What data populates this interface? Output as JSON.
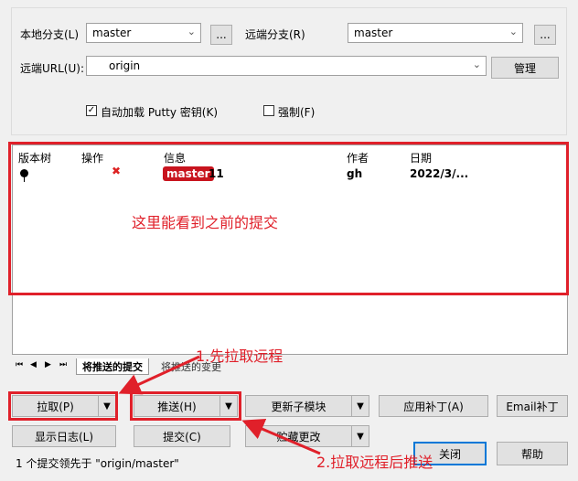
{
  "top": {
    "local_branch_label": "本地分支(L)",
    "local_branch_value": "master",
    "browse_local": "...",
    "remote_branch_label": "远端分支(R)",
    "remote_branch_value": "master",
    "browse_remote": "...",
    "remote_url_label": "远端URL(U):",
    "remote_url_value": "origin",
    "manage_button": "管理",
    "autoload_putty_label": "自动加载 Putty 密钥(K)",
    "autoload_putty_checked": true,
    "force_label": "强制(F)",
    "force_checked": false
  },
  "list": {
    "columns": [
      "版本树",
      "操作",
      "信息",
      "作者",
      "日期"
    ],
    "rows": [
      {
        "branch_tag": "master",
        "message": "11",
        "author": "gh",
        "date": "2022/3/..."
      }
    ]
  },
  "tabs": {
    "nav": [
      "⏮",
      "◀",
      "▶",
      "⏭"
    ],
    "items": [
      "将推送的提交",
      "将推送的变更"
    ]
  },
  "buttons": {
    "pull": "拉取(P)",
    "push": "推送(H)",
    "update_submodules": "更新子模块",
    "apply_patch": "应用补丁(A)",
    "email_patch": "Email补丁",
    "show_log": "显示日志(L)",
    "commit": "提交(C)",
    "stash": "贮藏更改",
    "close": "关闭",
    "help": "帮助"
  },
  "status": "1 个提交领先于 \"origin/master\"",
  "annotations": {
    "list_note": "这里能看到之前的提交",
    "step1": "1.先拉取远程",
    "step2": "2.拉取远程后推送"
  },
  "colors": {
    "annotation": "#e0202a",
    "branch_tag_bg": "#c8141e"
  }
}
